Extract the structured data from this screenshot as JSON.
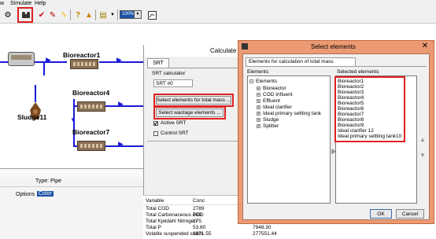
{
  "menu": {
    "view": "w",
    "simulate": "Simulate",
    "help": "Help"
  },
  "toolbar": {
    "zoom_value": "100%",
    "icons": [
      "tool-icon",
      "build-icon",
      "check-icon",
      "pipette-icon",
      "lightning-icon",
      "help-icon",
      "flask-icon",
      "folder-icon",
      "scale-icon",
      "chart-icon"
    ]
  },
  "canvas": {
    "labels": {
      "bioreactor1": "Bioreactor1",
      "bioreactor4": "Bioreactor4",
      "bioreactor7": "Bioreactor7",
      "sludge11": "Sludge11"
    }
  },
  "properties": {
    "type_label": "Type:",
    "type_value": "Pipe",
    "options_label": "Options",
    "options_value": "Color"
  },
  "calculate_window": {
    "title": "Calculate",
    "tab": "SRT",
    "group_label": "SRT calculator",
    "srt_value": "SRT #0",
    "select_total_mass_button": "Select elements for total mass ...",
    "select_wastage_button": "Select wastage elements ...",
    "active_srt_label": "Active SRT",
    "active_srt_checked": true,
    "control_srt_label": "Control SRT",
    "control_srt_checked": false
  },
  "results": {
    "col_variable": "Variable",
    "col_conc": "Conc",
    "rows": [
      {
        "name": "Total COD",
        "conc": "2789",
        "mass": ""
      },
      {
        "name": "Total Carbonaceous BOD",
        "conc": "769.",
        "mass": ""
      },
      {
        "name": "Total Kjeldahl Nitrogen",
        "conc": "175.",
        "mass": ""
      },
      {
        "name": "Total P",
        "conc": "53.60",
        "mass": "7948.30"
      },
      {
        "name": "Volatile suspended solids",
        "conc": "1871.55",
        "mass": "277551.44"
      }
    ]
  },
  "dialog": {
    "title": "Select elements",
    "tab": "Elements for calculation of total mass",
    "elements_header": "Elements",
    "selected_header": "Selected elements",
    "tree_root": "Elements",
    "tree_items": [
      "Bioreactor",
      "COD Influent",
      "Effluent",
      "Ideal clarifier",
      "Ideal primary settling tank",
      "Sludge",
      "Splitter"
    ],
    "selected_items": [
      "Bioreactor1",
      "Bioreactor2",
      "Bioreactor3",
      "Bioreactor4",
      "Bioreactor5",
      "Bioreactor6",
      "Bioreactor7",
      "Bioreactor8",
      "Bioreactor9",
      "Ideal clarifier 12",
      "Ideal primary settling tank10"
    ],
    "ok_button": "OK",
    "cancel_button": "Cancel"
  },
  "colors": {
    "pipe": "#1a1ad8",
    "highlight": "#e02020",
    "dialog_frame": "#eb9a73"
  }
}
